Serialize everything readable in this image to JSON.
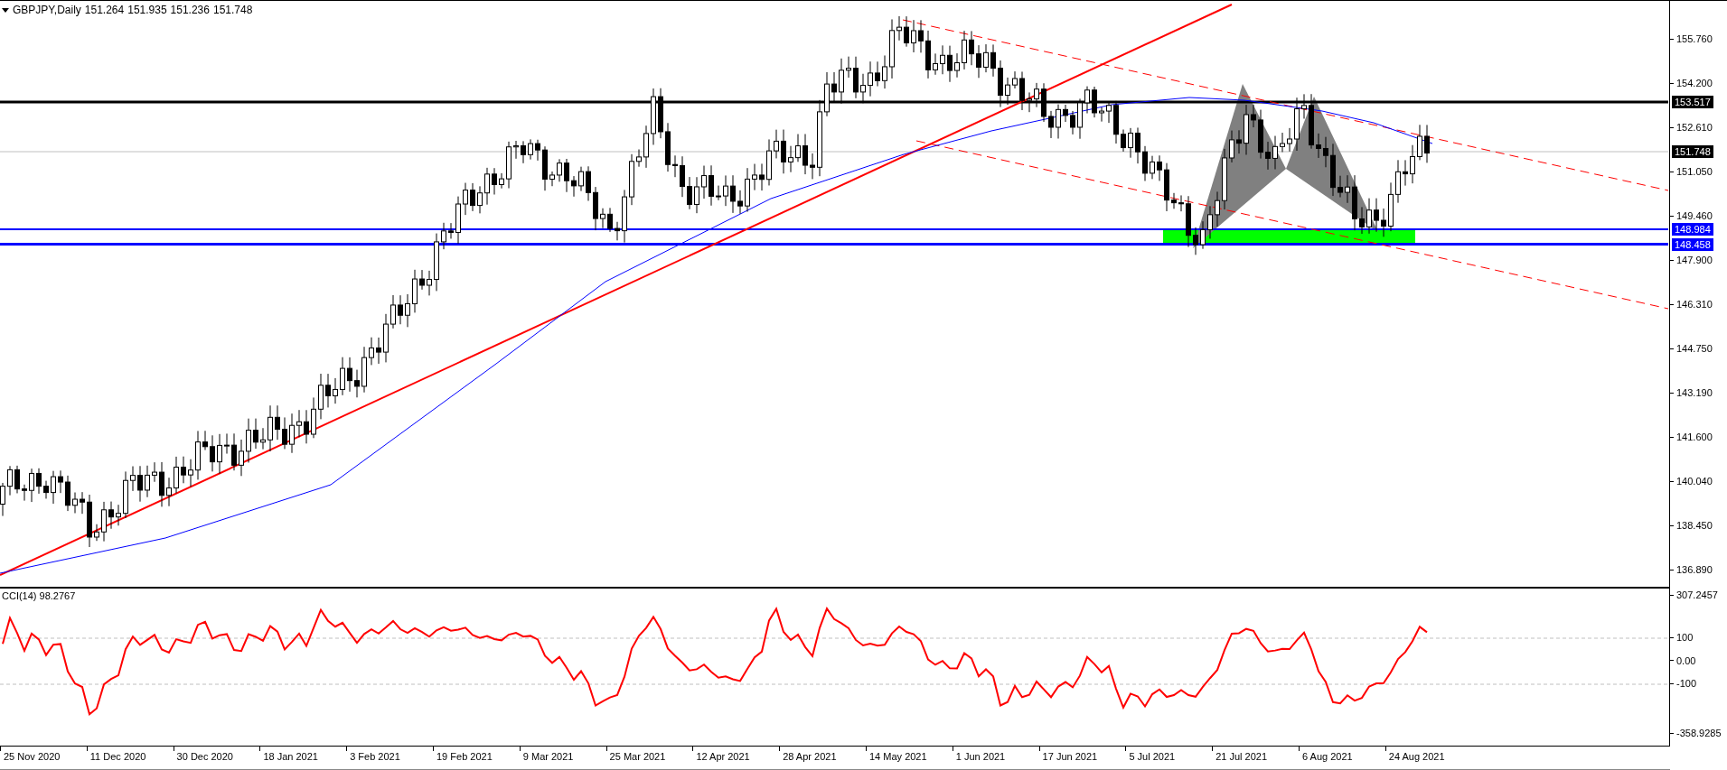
{
  "chart": {
    "symbol": "GBPJPY,Daily",
    "ohlc": [
      "151.264",
      "151.935",
      "151.236",
      "151.748"
    ],
    "price_ticks": [
      "155.760",
      "154.200",
      "152.610",
      "151.050",
      "149.460",
      "147.900",
      "146.310",
      "144.750",
      "143.190",
      "141.600",
      "140.040",
      "138.450",
      "136.890"
    ],
    "price_labels": [
      {
        "text": "153.517",
        "color": "#000000"
      },
      {
        "text": "151.748",
        "color": "#000000"
      },
      {
        "text": "148.984",
        "color": "#0000ff"
      },
      {
        "text": "148.458",
        "color": "#0000ff"
      }
    ]
  },
  "indicator": {
    "title": "CCI(14) 98.2767",
    "ticks": [
      "307.2457",
      "100",
      "0.00",
      "-100",
      "-358.9285"
    ]
  },
  "time_axis": {
    "labels": [
      "25 Nov 2020",
      "11 Dec 2020",
      "30 Dec 2020",
      "18 Jan 2021",
      "3 Feb 2021",
      "19 Feb 2021",
      "9 Mar 2021",
      "25 Mar 2021",
      "12 Apr 2021",
      "28 Apr 2021",
      "14 May 2021",
      "1 Jun 2021",
      "17 Jun 2021",
      "5 Jul 2021",
      "21 Jul 2021",
      "6 Aug 2021",
      "24 Aug 2021"
    ]
  }
}
